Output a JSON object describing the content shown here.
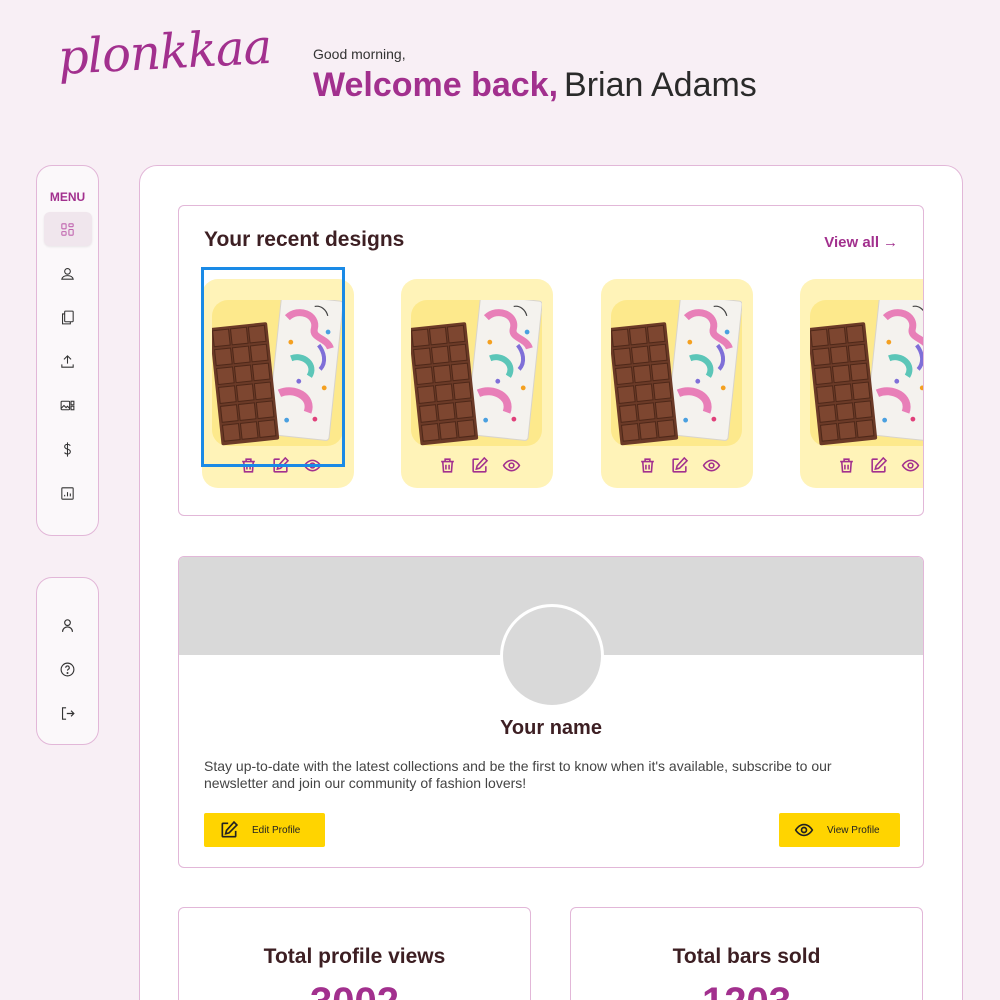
{
  "brand": {
    "logo_text": "plonkkaa",
    "accent_color": "#a2308e"
  },
  "header": {
    "greeting": "Good morning,",
    "welcome": "Welcome back,",
    "user_name": "Brian Adams"
  },
  "sidebar": {
    "menu_title": "MENU",
    "items": [
      {
        "icon": "dashboard-icon",
        "active": true
      },
      {
        "icon": "user-circle-icon"
      },
      {
        "icon": "documents-icon"
      },
      {
        "icon": "upload-icon"
      },
      {
        "icon": "gallery-icon"
      },
      {
        "icon": "dollar-icon"
      },
      {
        "icon": "analytics-icon"
      }
    ],
    "bottom_items": [
      {
        "icon": "profile-icon"
      },
      {
        "icon": "help-icon"
      },
      {
        "icon": "logout-icon"
      }
    ]
  },
  "recent_designs": {
    "title": "Your recent designs",
    "view_all": "View all",
    "designs": [
      {
        "selected": true
      },
      {
        "selected": false
      },
      {
        "selected": false
      },
      {
        "selected": false
      }
    ]
  },
  "profile": {
    "name": "Your name",
    "bio": "Stay up-to-date with the latest collections and be the first to know when it's available, subscribe to our newsletter and join our community of fashion lovers!",
    "edit_label": "Edit Profile",
    "view_label": "View Profile"
  },
  "stats": {
    "profile_views_label": "Total profile views",
    "profile_views_value": "3002",
    "bars_sold_label": "Total bars sold",
    "bars_sold_value": "1203"
  }
}
